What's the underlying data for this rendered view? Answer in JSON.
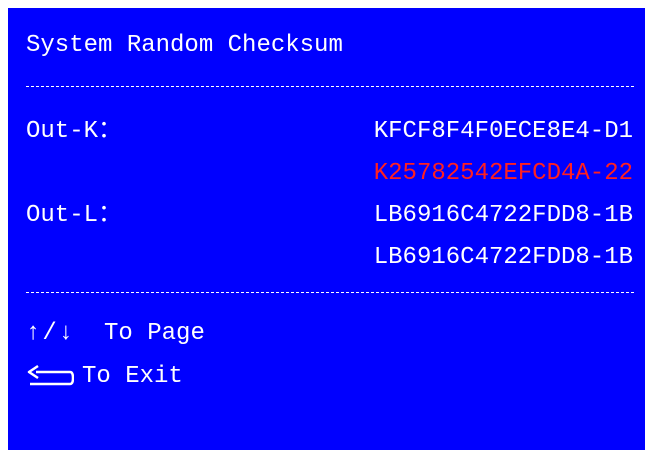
{
  "title": "System Random Checksum",
  "out_k": {
    "label": "Out-K：",
    "values": [
      "KFCF8F4F0ECE8E4-D1",
      "K25782542EFCD4A-22"
    ]
  },
  "out_l": {
    "label": "Out-L：",
    "values": [
      "LB6916C4722FDD8-1B",
      "LB6916C4722FDD8-1B"
    ]
  },
  "nav": {
    "page_arrows": "↑/↓",
    "page_label": "To Page",
    "exit_icon": "return-icon",
    "exit_label": "To Exit"
  },
  "colors": {
    "background": "#0000ff",
    "text": "#ffffff",
    "mismatch": "#ff2020"
  }
}
